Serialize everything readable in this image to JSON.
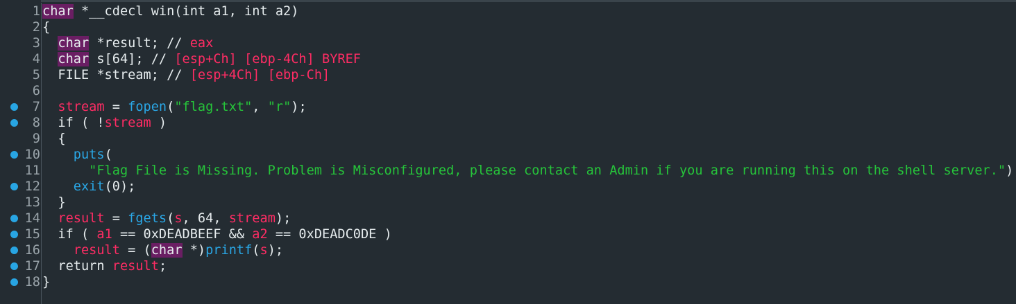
{
  "lines": [
    {
      "n": "1",
      "bp": false
    },
    {
      "n": "2",
      "bp": false
    },
    {
      "n": "3",
      "bp": false
    },
    {
      "n": "4",
      "bp": false
    },
    {
      "n": "5",
      "bp": false
    },
    {
      "n": "6",
      "bp": false
    },
    {
      "n": "7",
      "bp": true
    },
    {
      "n": "8",
      "bp": true
    },
    {
      "n": "9",
      "bp": false
    },
    {
      "n": "10",
      "bp": true
    },
    {
      "n": "11",
      "bp": false
    },
    {
      "n": "12",
      "bp": true
    },
    {
      "n": "13",
      "bp": false
    },
    {
      "n": "14",
      "bp": true
    },
    {
      "n": "15",
      "bp": true
    },
    {
      "n": "16",
      "bp": true
    },
    {
      "n": "17",
      "bp": true
    },
    {
      "n": "18",
      "bp": true
    }
  ],
  "tok": {
    "char": "char",
    "cdecl": " *__cdecl win(int a1, int a2)",
    "lbrace": "{",
    "rbrace": "}",
    "indent2": "  ",
    "indent4": "    ",
    "indent6": "      ",
    "star_result": " *result; // ",
    "eax": "eax",
    "s64": " s[64]; // ",
    "s_regs": "[esp+Ch] [ebp-4Ch] BYREF",
    "file_stream": "FILE *stream; // ",
    "stream_regs": "[esp+4Ch] [ebp-Ch]",
    "stream": "stream",
    "eq": " = ",
    "fopen": "fopen",
    "fopen_args_open": "(",
    "flagtxt": "\"flag.txt\"",
    "comma_sp": ", ",
    "r": "\"r\"",
    "close_semi": ");",
    "if_not_open": "if ( !",
    "if_not_close": " )",
    "puts": "puts",
    "lparen": "(",
    "msg": "\"Flag File is Missing. Problem is Misconfigured, please contact an Admin if you are running this on the shell server.\"",
    "exit": "exit",
    "exit_arg": "(0);",
    "result": "result",
    "fgets": "fgets",
    "s": "s",
    "sixtyfour": ", 64, ",
    "if_open": "if ( ",
    "a1": "a1",
    "cmp1": " == 0xDEADBEEF && ",
    "a2": "a2",
    "cmp2": " == 0xDEADC0DE )",
    "cast_open": " = (",
    "cast_close": " *)",
    "printf": "printf",
    "return": "return ",
    "semi": ";"
  }
}
